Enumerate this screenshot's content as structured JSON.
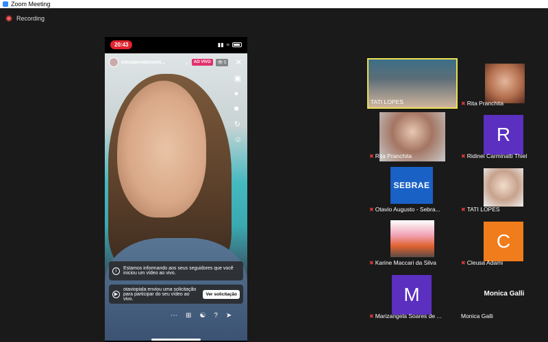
{
  "window": {
    "title": "Zoom Meeting"
  },
  "recording": {
    "label": "Recording",
    "color": "#ff5c5c"
  },
  "share": {
    "time": "20:43",
    "username": "edicaoevideosem...",
    "live_label": "AO VIVO",
    "viewers": "5",
    "notice_1": "Estamos informando aos seus seguidores que você iniciou um vídeo ao vivo.",
    "notice_2": "otaviopiala enviou uma solicitação para participar do seu vídeo ao vivo.",
    "request_button": "Ver solicitação"
  },
  "gallery": {
    "participants": [
      {
        "name": "TATI LOPES",
        "muted": false,
        "active": true
      },
      {
        "name": "Rita Pranchita",
        "muted": true,
        "active": false
      },
      {
        "name": "Rita Pranchita",
        "muted": true,
        "active": false
      },
      {
        "name": "Ridinei Carminatti Thiel",
        "muted": true,
        "active": false,
        "letter": "R",
        "color": "#5b2fc0"
      },
      {
        "name": "Otavio Augusto - Sebra...",
        "muted": true,
        "active": false,
        "logo": "SEBRAE"
      },
      {
        "name": "TATI LOPES",
        "muted": true,
        "active": false
      },
      {
        "name": "Karine Maccari da Silva",
        "muted": true,
        "active": false
      },
      {
        "name": "Cleusa Adami",
        "muted": true,
        "active": false,
        "letter": "C",
        "color": "#f07c1c"
      },
      {
        "name": "Marizangela Soares de ...",
        "muted": true,
        "active": false,
        "letter": "M",
        "color": "#5b2fc0"
      },
      {
        "name": "Monica Galli",
        "muted": false,
        "active": false,
        "display_name": "Monica Galli"
      }
    ]
  },
  "colors": {
    "active_speaker": "#e8e254",
    "live_badge": "#e1306c",
    "time_pill": "#e0242f"
  }
}
